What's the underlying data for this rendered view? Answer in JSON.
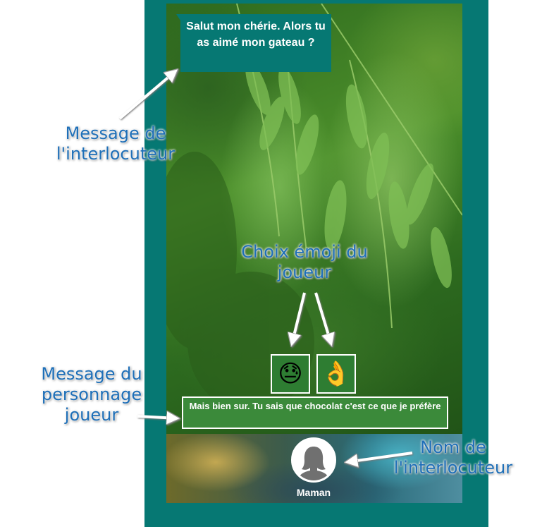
{
  "colors": {
    "frame": "#067873",
    "bubble": "#067873",
    "annotation": "#1e6fb8",
    "player_message": "#3b8a3a"
  },
  "chat": {
    "incoming_message": "Salut mon chérie. Alors tu as aimé mon gateau ?",
    "emoji_choices": [
      {
        "icon": "downcast-sweat-face-icon",
        "glyph": "😓"
      },
      {
        "icon": "ok-hand-icon",
        "glyph": "👌"
      }
    ],
    "player_message": "Mais bien sur. Tu sais que chocolat c'est ce que je préfère",
    "contact": {
      "name": "Maman",
      "avatar_icon": "person-silhouette-icon"
    }
  },
  "annotations": {
    "incoming": "Message de l'interlocuteur",
    "emoji": "Choix émoji du joueur",
    "player": "Message du personnage joueur",
    "contact_name": "Nom de l'interlocuteur"
  }
}
